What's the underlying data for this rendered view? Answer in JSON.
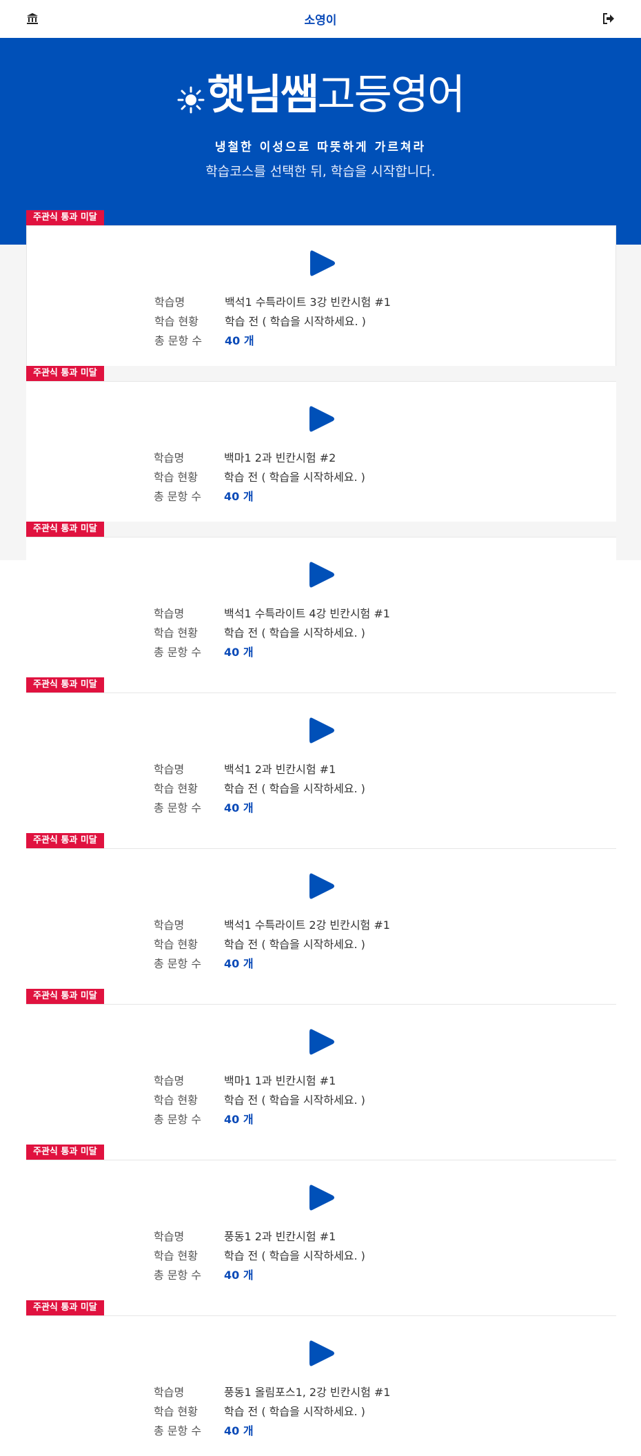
{
  "header": {
    "user_name": "소영이",
    "home_icon": "institution-icon",
    "logout_icon": "sign-out-icon"
  },
  "hero": {
    "logo_bold": "햇님쌤",
    "logo_light": "고등영어",
    "slogan": "냉철한 이성으로 따뜻하게 가르쳐라",
    "subtitle": "학습코스를 선택한 뒤, 학습을 시작합니다."
  },
  "labels": {
    "name": "학습명",
    "status": "학습 현황",
    "count": "총 문항 수"
  },
  "courses": [
    {
      "badge": "주관식 통과 미달",
      "name": "백석1 수특라이트 3강 빈칸시험 #1",
      "status": "학습 전 ( 학습을 시작하세요. )",
      "count": "40 개"
    },
    {
      "badge": "주관식 통과 미달",
      "name": "백마1 2과 빈칸시험 #2",
      "status": "학습 전 ( 학습을 시작하세요. )",
      "count": "40 개"
    },
    {
      "badge": "주관식 통과 미달",
      "name": "백석1 수특라이트 4강 빈칸시험 #1",
      "status": "학습 전 ( 학습을 시작하세요. )",
      "count": "40 개"
    },
    {
      "badge": "주관식 통과 미달",
      "name": "백석1 2과 빈칸시험 #1",
      "status": "학습 전 ( 학습을 시작하세요. )",
      "count": "40 개"
    },
    {
      "badge": "주관식 통과 미달",
      "name": "백석1 수특라이트 2강 빈칸시험 #1",
      "status": "학습 전 ( 학습을 시작하세요. )",
      "count": "40 개"
    },
    {
      "badge": "주관식 통과 미달",
      "name": "백마1 1과 빈칸시험 #1",
      "status": "학습 전 ( 학습을 시작하세요. )",
      "count": "40 개"
    },
    {
      "badge": "주관식 통과 미달",
      "name": "풍동1 2과 빈칸시험 #1",
      "status": "학습 전 ( 학습을 시작하세요. )",
      "count": "40 개"
    },
    {
      "badge": "주관식 통과 미달",
      "name": "풍동1 올림포스1, 2강 빈칸시험 #1",
      "status": "학습 전 ( 학습을 시작하세요. )",
      "count": "40 개"
    }
  ],
  "colors": {
    "brand_blue": "#0050b8",
    "badge_red": "#e0123f",
    "count_blue": "#0a4ab8"
  }
}
